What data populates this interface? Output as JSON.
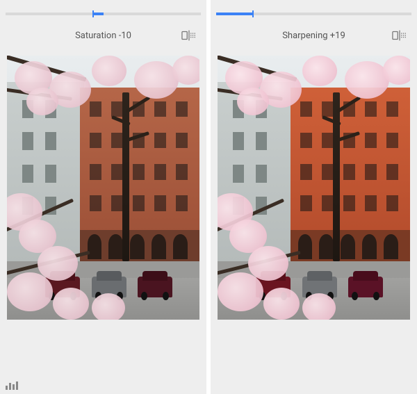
{
  "left": {
    "slider": {
      "label": "Saturation -10",
      "value": -10,
      "min": -100,
      "max": 100,
      "origin": "center"
    },
    "compare_icon": "compare-icon"
  },
  "right": {
    "slider": {
      "label": "Sharpening +19",
      "value": 19,
      "min": 0,
      "max": 100,
      "origin": "left"
    },
    "compare_icon": "compare-icon"
  },
  "bottom": {
    "histogram_icon": "histogram-icon"
  }
}
